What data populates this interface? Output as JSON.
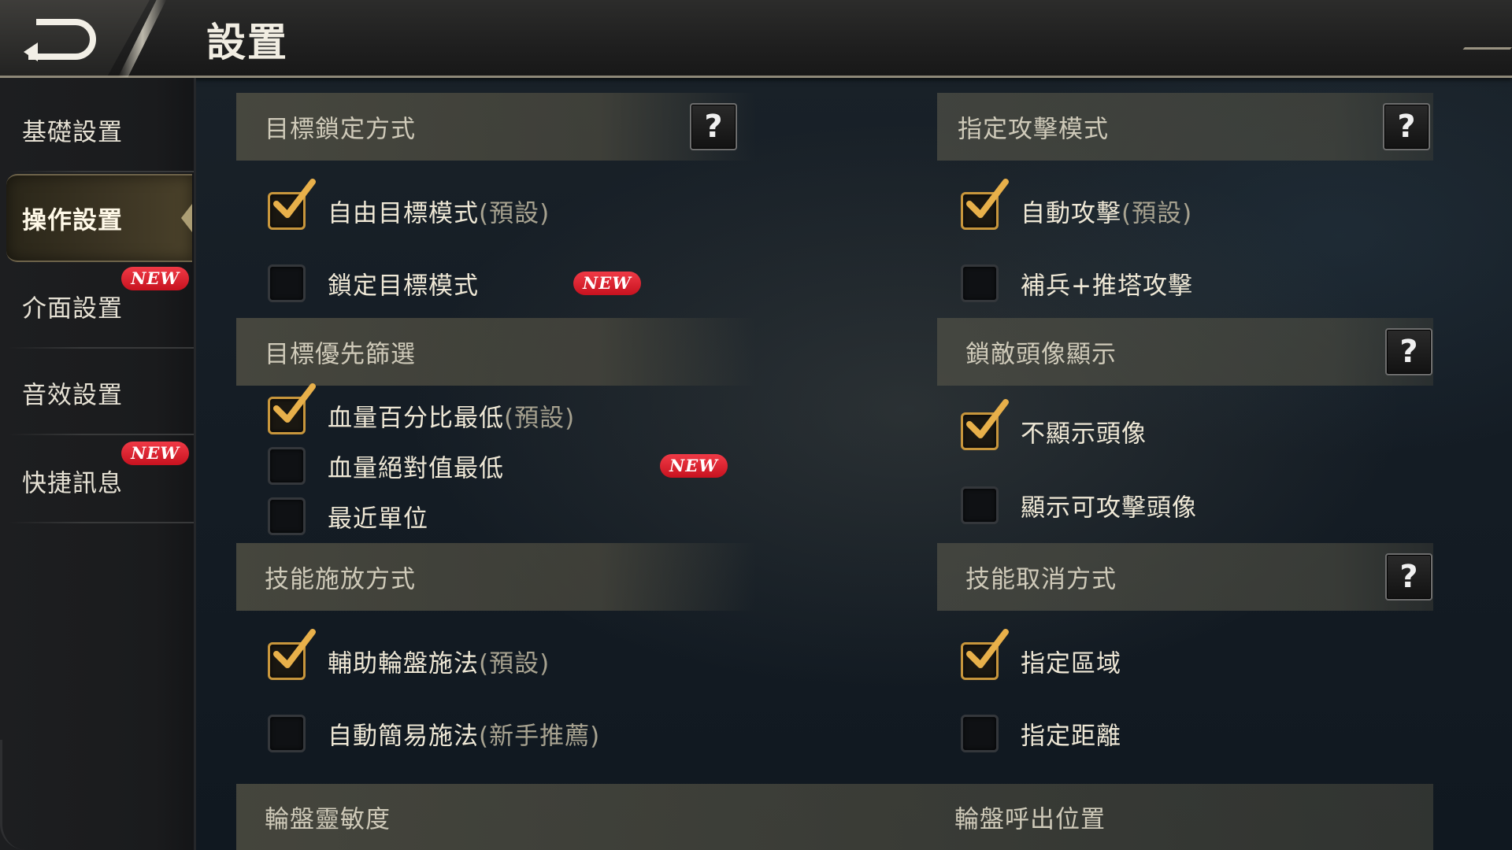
{
  "header": {
    "title": "設置",
    "back_icon": "back-arrow-icon"
  },
  "sidebar": {
    "items": [
      {
        "label": "基礎設置",
        "active": false,
        "badge": ""
      },
      {
        "label": "操作設置",
        "active": true,
        "badge": ""
      },
      {
        "label": "介面設置",
        "active": false,
        "badge": "NEW"
      },
      {
        "label": "音效設置",
        "active": false,
        "badge": ""
      },
      {
        "label": "快捷訊息",
        "active": false,
        "badge": "NEW"
      }
    ]
  },
  "sections": {
    "target_lock": {
      "title": "目標鎖定方式",
      "help": "?",
      "options": [
        {
          "label": "自由目標模式",
          "note": "(預設)",
          "checked": true
        },
        {
          "label": "鎖定目標模式",
          "note": "",
          "checked": false,
          "badge": "NEW"
        }
      ]
    },
    "attack_mode": {
      "title": "指定攻擊模式",
      "help": "?",
      "options": [
        {
          "label": "自動攻擊",
          "note": "(預設)",
          "checked": true
        },
        {
          "label": "補兵+推塔攻擊",
          "note": "",
          "checked": false
        }
      ]
    },
    "target_priority": {
      "title": "目標優先篩選",
      "options": [
        {
          "label": "血量百分比最低",
          "note": "(預設)",
          "checked": true
        },
        {
          "label": "血量絕對值最低",
          "note": "",
          "checked": false,
          "badge": "NEW"
        },
        {
          "label": "最近單位",
          "note": "",
          "checked": false
        }
      ]
    },
    "lock_avatar": {
      "title": "鎖敵頭像顯示",
      "help": "?",
      "options": [
        {
          "label": "不顯示頭像",
          "note": "",
          "checked": true
        },
        {
          "label": "顯示可攻擊頭像",
          "note": "",
          "checked": false
        }
      ]
    },
    "skill_cast": {
      "title": "技能施放方式",
      "options": [
        {
          "label": "輔助輪盤施法",
          "note": "(預設)",
          "checked": true
        },
        {
          "label": "自動簡易施法",
          "note": "(新手推薦)",
          "checked": false
        }
      ]
    },
    "skill_cancel": {
      "title": "技能取消方式",
      "help": "?",
      "options": [
        {
          "label": "指定區域",
          "note": "",
          "checked": true
        },
        {
          "label": "指定距離",
          "note": "",
          "checked": false
        }
      ]
    },
    "wheel_sensitivity": {
      "title": "輪盤靈敏度"
    },
    "wheel_position": {
      "title": "輪盤呼出位置"
    }
  },
  "colors": {
    "accent_gold": "#c8963c",
    "badge_red": "#e0202e",
    "text_main": "#efe8d6",
    "text_note": "#a7a290"
  }
}
